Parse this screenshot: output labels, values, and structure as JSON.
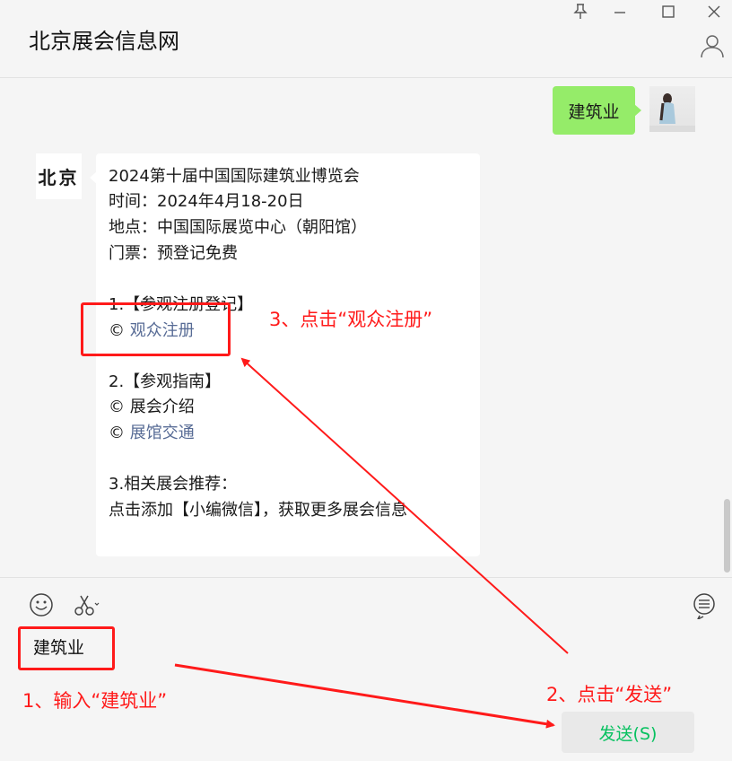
{
  "header": {
    "chat_title": "北京展会信息网",
    "pin_icon": "pin-icon",
    "minimize_icon": "minimize-icon",
    "maximize_icon": "maximize-icon",
    "close_icon": "close-icon",
    "profile_icon": "user-profile-icon"
  },
  "messages": {
    "sent": {
      "text": "建筑业",
      "avatar": "user-avatar"
    },
    "received": {
      "avatar_text": "北京",
      "lines": [
        "2024第十届中国国际建筑业博览会",
        "时间：2024年4月18-20日",
        "地点：中国国际展览中心（朝阳馆）",
        "门票：预登记免费",
        "1.【参观注册登记】",
        "©",
        "观众注册",
        "2.【参观指南】",
        "© 展会介绍",
        "©",
        "展馆交通",
        "3.相关展会推荐：",
        "点击添加【小编微信】，获取更多展会信息"
      ]
    }
  },
  "input": {
    "emoji_icon": "emoji-icon",
    "scissors_icon": "scissors-icon",
    "chat_history_icon": "chat-history-icon",
    "text": "建筑业",
    "send_label": "发送(S)"
  },
  "annotations": {
    "step1": "1、输入“建筑业”",
    "step2": "2、点击“发送”",
    "step3": "3、点击“观众注册”",
    "color": "#ff1a1a"
  },
  "colors": {
    "sent_bubble": "#95ec69",
    "link": "#576b95",
    "send_text": "#07c160",
    "background": "#f5f5f5"
  }
}
